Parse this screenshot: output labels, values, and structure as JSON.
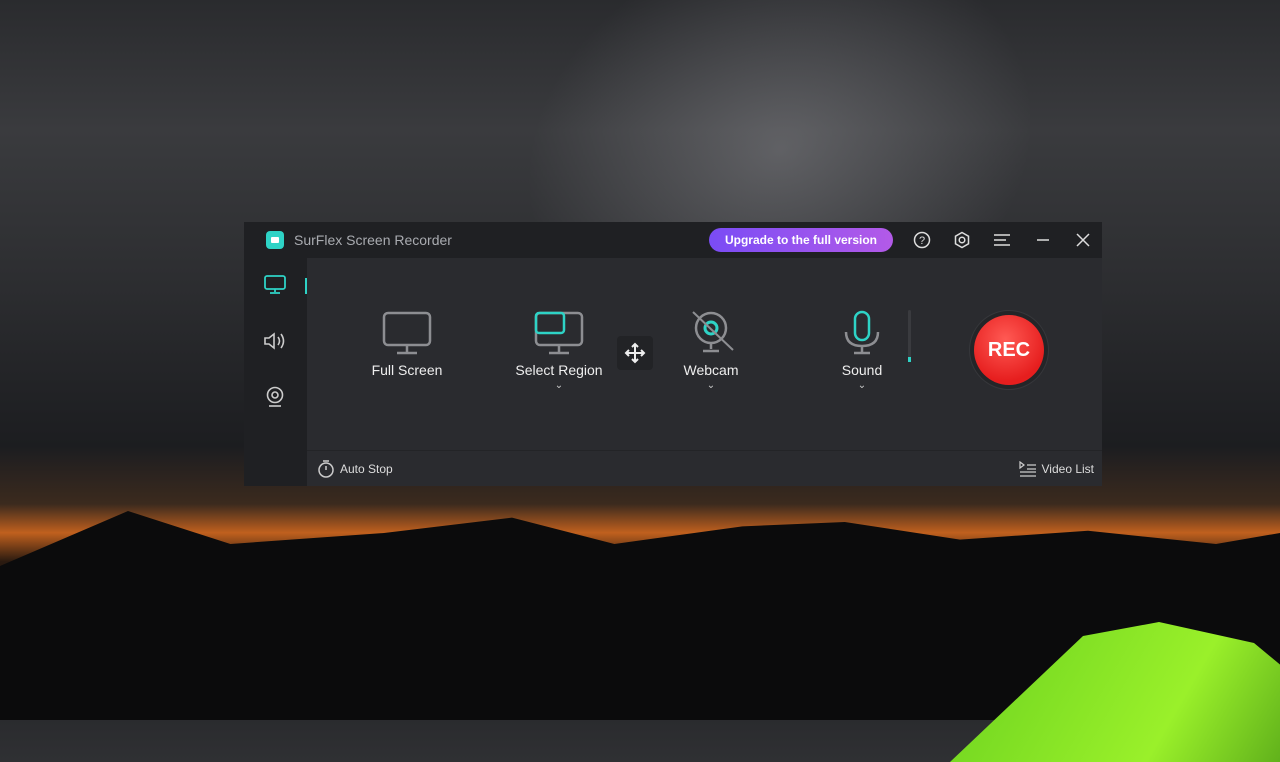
{
  "window": {
    "title": "SurFlex Screen Recorder",
    "upgrade_label": "Upgrade to the full version"
  },
  "modes": [
    {
      "label": "Full Screen"
    },
    {
      "label": "Select Region"
    },
    {
      "label": "Webcam"
    },
    {
      "label": "Sound"
    }
  ],
  "sound_level": 0.1,
  "rec_label": "REC",
  "footer": {
    "auto_stop": "Auto Stop",
    "video_list": "Video List"
  },
  "colors": {
    "accent": "#2ed3c6",
    "rec": "#e61e1e",
    "upgrade": "#8a4cf0"
  }
}
